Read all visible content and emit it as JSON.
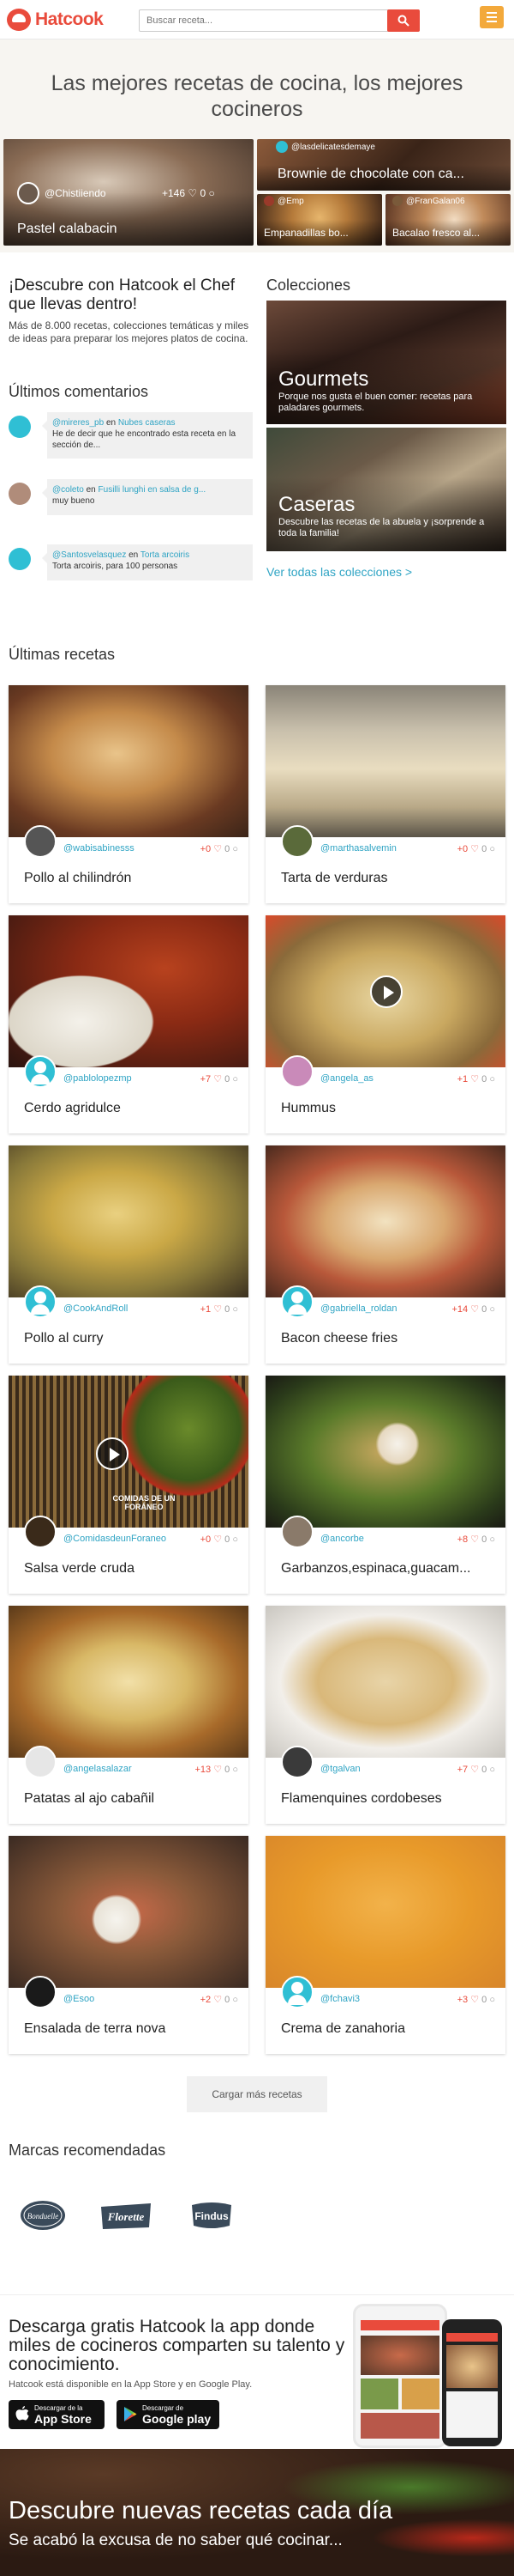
{
  "header": {
    "logo_text": "Hatcook",
    "search_placeholder": "Buscar receta..."
  },
  "hero": {
    "title": "Las mejores recetas de cocina, los mejores cocineros",
    "featured_main": {
      "title": "Pastel calabacin",
      "user": "@Chistiiendo",
      "likes": "+146",
      "comments": "0"
    },
    "featured": [
      {
        "title": "Brownie de chocolate con ca...",
        "user": "@lasdelicatesdemaye"
      },
      {
        "title": "Empanadillas bo...",
        "user": "@Emp"
      },
      {
        "title": "Bacalao fresco al...",
        "user": "@FranGalan06"
      }
    ]
  },
  "intro": {
    "title": "¡Descubre con Hatcook el Chef que llevas dentro!",
    "text": "Más de 8.000 recetas, colecciones temáticas y miles de ideas para preparar los mejores platos de cocina."
  },
  "comments": {
    "title": "Últimos comentarios",
    "connector": "en",
    "items": [
      {
        "user": "@mireres_pb",
        "recipe": "Nubes caseras",
        "text": "He de decir que he encontrado esta receta en la sección de..."
      },
      {
        "user": "@coleto",
        "recipe": "Fusilli lunghi en salsa de g...",
        "text": "muy bueno"
      },
      {
        "user": "@Santosvelasquez",
        "recipe": "Torta arcoiris",
        "text": "Torta arcoiris, para 100 personas"
      }
    ]
  },
  "collections": {
    "title": "Colecciones",
    "items": [
      {
        "name": "Gourmets",
        "desc": "Porque nos gusta el buen comer: recetas para paladares gourmets."
      },
      {
        "name": "Caseras",
        "desc": "Descubre las recetas de la abuela y ¡sorprende a toda la familia!"
      }
    ],
    "see_all": "Ver todas las colecciones >"
  },
  "latest": {
    "title": "Últimas recetas",
    "recipes": [
      {
        "title": "Pollo al chilindrón",
        "user": "@wabisabinesss",
        "likes": "+0",
        "comments": "0"
      },
      {
        "title": "Tarta de verduras",
        "user": "@marthasalvemin",
        "likes": "+0",
        "comments": "0"
      },
      {
        "title": "Cerdo agridulce",
        "user": "@pablolopezmp",
        "likes": "+7",
        "comments": "0"
      },
      {
        "title": "Hummus",
        "user": "@angela_as",
        "likes": "+1",
        "comments": "0"
      },
      {
        "title": "Pollo al curry",
        "user": "@CookAndRoll",
        "likes": "+1",
        "comments": "0"
      },
      {
        "title": "Bacon cheese fries",
        "user": "@gabriella_roldan",
        "likes": "+14",
        "comments": "0"
      },
      {
        "title": "Salsa verde cruda",
        "user": "@ComidasdeunForaneo",
        "likes": "+0",
        "comments": "0",
        "watermark": "COMIDAS DE UN FORÁNEO"
      },
      {
        "title": "Garbanzos,espinaca,guacam...",
        "user": "@ancorbe",
        "likes": "+8",
        "comments": "0"
      },
      {
        "title": "Patatas al ajo cabañil",
        "user": "@angelasalazar",
        "likes": "+13",
        "comments": "0"
      },
      {
        "title": "Flamenquines cordobeses",
        "user": "@tgalvan",
        "likes": "+7",
        "comments": "0"
      },
      {
        "title": "Ensalada de terra nova",
        "user": "@Esoo",
        "likes": "+2",
        "comments": "0"
      },
      {
        "title": "Crema de zanahoria",
        "user": "@fchavi3",
        "likes": "+3",
        "comments": "0"
      }
    ],
    "load_more": "Cargar más recetas"
  },
  "brands": {
    "title": "Marcas recomendadas",
    "items": [
      "Bonduelle",
      "Florette",
      "Findus"
    ]
  },
  "app": {
    "title": "Descarga gratis Hatcook la app donde miles de cocineros comparten su talento y conocimiento.",
    "text": "Hatcook está disponible en la App Store y en Google Play.",
    "appstore_small": "Descargar de la",
    "appstore_big": "App Store",
    "gplay_small": "Descargar de",
    "gplay_big": "Google play"
  },
  "footer": {
    "title": "Descubre nuevas recetas cada día",
    "subtitle": "Se acabó la excusa de no saber qué cocinar..."
  }
}
